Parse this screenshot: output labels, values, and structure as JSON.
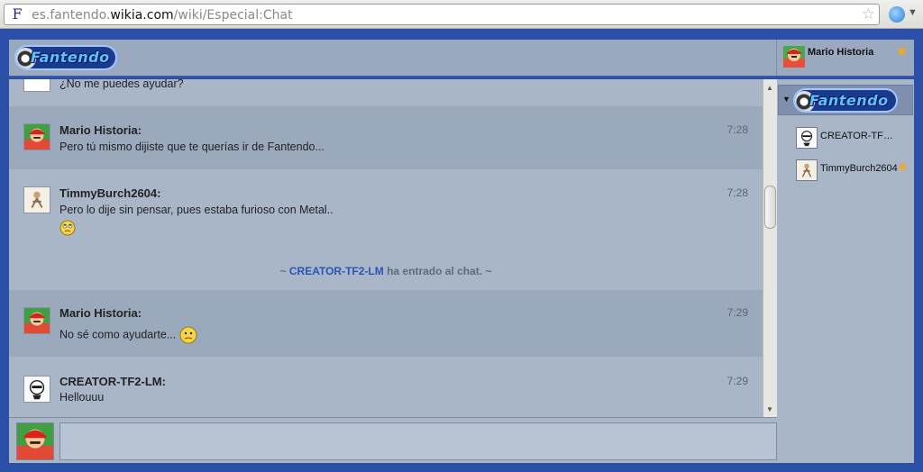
{
  "browser": {
    "favicon": "F",
    "url_prefix": "es.fantendo.",
    "url_domain": "wikia.com",
    "url_path": "/wiki/Especial:Chat",
    "bookmark_icon": "star-outline-icon",
    "extension_icon": "music-icon"
  },
  "header": {
    "logo_text": "Fantendo",
    "current_user": "Mario Historia",
    "current_user_badge": "star-icon"
  },
  "messages": [
    {
      "text": "¿No me puedes ayudar?",
      "partial": true
    },
    {
      "user": "Mario Historia:",
      "time": "7:28",
      "text": "Pero tú mismo dijiste que te querías ir de Fantendo..."
    },
    {
      "user": "TimmyBurch2604:",
      "time": "7:28",
      "text": "Pero lo dije sin pensar, pues estaba furioso con Metal..",
      "emoticon": "rolling-eyes-emoticon"
    },
    {
      "user": "Mario Historia:",
      "time": "7:29",
      "text": "No sé como ayudarte...",
      "emoticon": "confused-emoticon"
    },
    {
      "user": "CREATOR-TF2-LM:",
      "time": "7:29",
      "text": "Hellouuu"
    }
  ],
  "system": {
    "prefix": "~ ",
    "user": "CREATOR-TF2-LM",
    "suffix": " ha entrado al chat. ~"
  },
  "composer": {
    "value": ""
  },
  "userlist": {
    "room_name": "Fantendo",
    "users": [
      {
        "name": "CREATOR-TF2-LM",
        "badge": ""
      },
      {
        "name": "TimmyBurch2604",
        "badge": "star-icon"
      }
    ]
  },
  "colors": {
    "page_bg": "#2c4fa8",
    "chat_bg": "#a9b6c8",
    "alt_row_bg": "#9ba9bd",
    "system_user": "#2a55b5",
    "star": "#f0a821"
  }
}
